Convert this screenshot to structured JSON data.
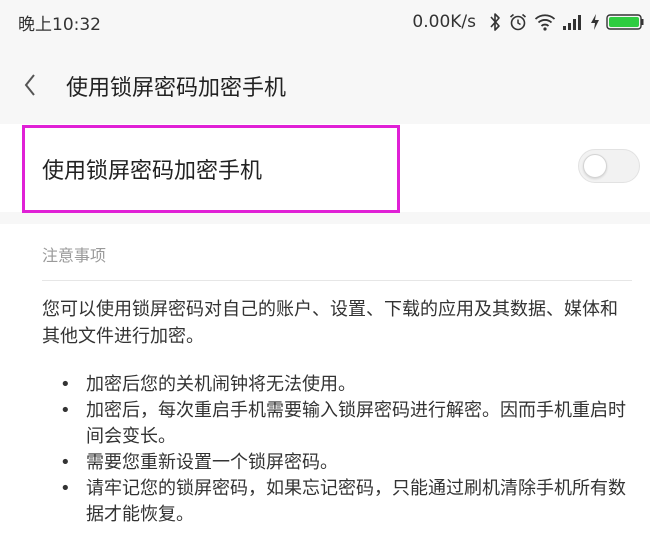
{
  "status_bar": {
    "time": "晚上10:32",
    "net_speed": "0.00K/s",
    "icons": [
      "bluetooth-icon",
      "alarm-icon",
      "wifi-icon",
      "signal-icon",
      "charging-icon",
      "battery-icon"
    ],
    "battery_color": "#2ecc40"
  },
  "header": {
    "back_icon": "chevron-left-icon",
    "title": "使用锁屏密码加密手机"
  },
  "setting": {
    "label": "使用锁屏密码加密手机",
    "toggle_on": false,
    "highlight_color": "#e020d6"
  },
  "notes": {
    "heading": "注意事项",
    "intro": "您可以使用锁屏密码对自己的账户、设置、下载的应用及其数据、媒体和其他文件进行加密。",
    "bullet": "•",
    "items": [
      "加密后您的关机闹钟将无法使用。",
      "加密后，每次重启手机需要输入锁屏密码进行解密。因而手机重启时间会变长。",
      "需要您重新设置一个锁屏密码。",
      "请牢记您的锁屏密码，如果忘记密码，只能通过刷机清除手机所有数据才能恢复。"
    ]
  }
}
